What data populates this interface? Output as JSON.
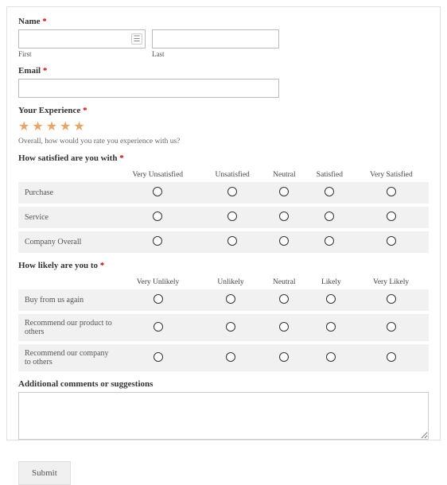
{
  "name": {
    "label": "Name",
    "first_sublabel": "First",
    "last_sublabel": "Last",
    "first_value": "",
    "last_value": ""
  },
  "email": {
    "label": "Email",
    "value": ""
  },
  "experience": {
    "label": "Your Experience",
    "hint": "Overall, how would you rate you experience with us?",
    "rating": 5
  },
  "satisfaction": {
    "label": "How satisfied are you with",
    "columns": [
      "Very Unsatisfied",
      "Unsatisfied",
      "Neutral",
      "Satisfied",
      "Very Satisfied"
    ],
    "rows": [
      "Purchase",
      "Service",
      "Company Overall"
    ]
  },
  "likelihood": {
    "label": "How likely are you to",
    "columns": [
      "Very Unlikely",
      "Unlikely",
      "Neutral",
      "Likely",
      "Very Likely"
    ],
    "rows": [
      "Buy from us again",
      "Recommend our product to others",
      "Recommend our company to others"
    ]
  },
  "comments": {
    "label": "Additional comments or suggestions",
    "value": ""
  },
  "submit": {
    "label": "Submit"
  },
  "required_marker": "*"
}
